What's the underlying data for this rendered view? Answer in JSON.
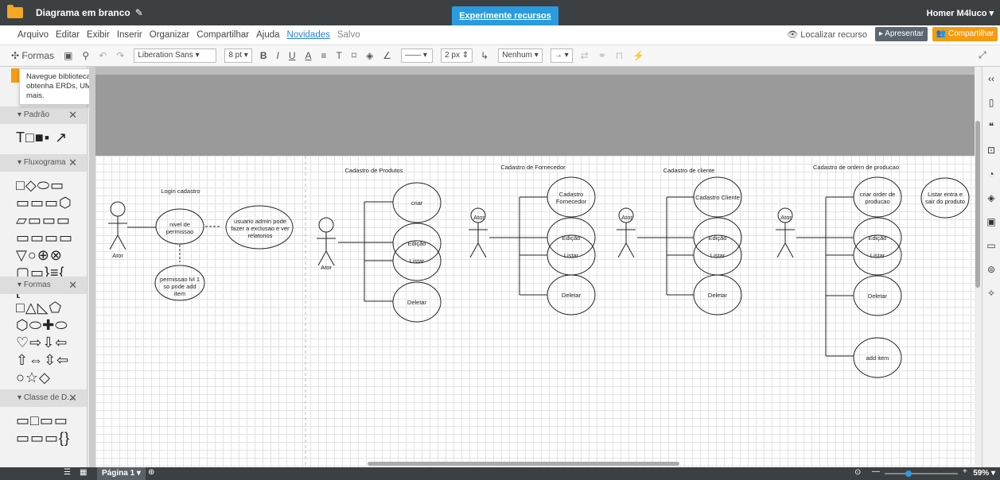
{
  "titlebar": {
    "doc_title": "Diagrama em branco",
    "promo": "Experimente recursos pagos",
    "user": "Homer M4luco ▾"
  },
  "menu": {
    "items": [
      "Arquivo",
      "Editar",
      "Exibir",
      "Inserir",
      "Organizar",
      "Compartilhar",
      "Ajuda"
    ],
    "news": "Novidades",
    "saved": "Salvo"
  },
  "actions": {
    "locate": "Localizar recurso",
    "present": "▸ Apresentar",
    "share": "Compartilhar"
  },
  "toolbar": {
    "shapes": "Formas",
    "font": "Liberation Sans",
    "font_size": "8 pt",
    "stroke": "2 px",
    "arrow_start": "Nenhum"
  },
  "tooltip": {
    "text": "Navegue bibliotecas de formas e obtenha ERDs, UML, mapas mentais e mais."
  },
  "sidebar": {
    "panels": [
      {
        "title": "Padrão",
        "glyphs": "T□■▪ ↗"
      },
      {
        "title": "Fluxograma",
        "glyphs": "□◇⬭▭ ▭▭▭⬡ ▱▭▭▭ ▭▭▭▭ ▽○⊕⊗ ▢▭}≡{ ["
      },
      {
        "title": "Formas",
        "glyphs": "□△◺⬠ ⬡⬭✚⬭ ♡⇨⇩⇦ ⇧⇔⇳⇦ ○☆◇"
      },
      {
        "title": "Classe de D...",
        "glyphs": "▭□▭▭ ▭▭▭{}"
      }
    ]
  },
  "diagram": {
    "login": {
      "title": "Login cadastro",
      "actor": "Ator",
      "nivel": "nivel de permissao",
      "admin": "usuario admin pode fazer a exclusao e ver relatorios",
      "lvl1": "permissao lvl 1 so pode add item"
    },
    "produtos": {
      "title": "Cadastro de Produtos",
      "actor": "Ator",
      "cases": [
        "criar",
        "Edição",
        "Listar",
        "Deletar"
      ]
    },
    "fornecedor": {
      "title": "Cadastro de Fornecedor",
      "actor": "Ator",
      "cases": [
        "Cadastro Fornecedor",
        "Edição",
        "Listar",
        "Deletar"
      ]
    },
    "cliente": {
      "title": "Cadastro de cliente",
      "actor": "Ator",
      "cases": [
        "Cadastro Cliente",
        "Edição",
        "Listar",
        "Deletar"
      ]
    },
    "ordem": {
      "title": "Cadastro de ordem de producao",
      "actor": "Ator",
      "cases": [
        "criar order de producao",
        "Edição",
        "Listar",
        "Deletar",
        "add item"
      ],
      "extra": "Listar entra e sair do produto"
    }
  },
  "bottombar": {
    "page": "Página 1 ▾",
    "zoom": "59% ▾"
  }
}
